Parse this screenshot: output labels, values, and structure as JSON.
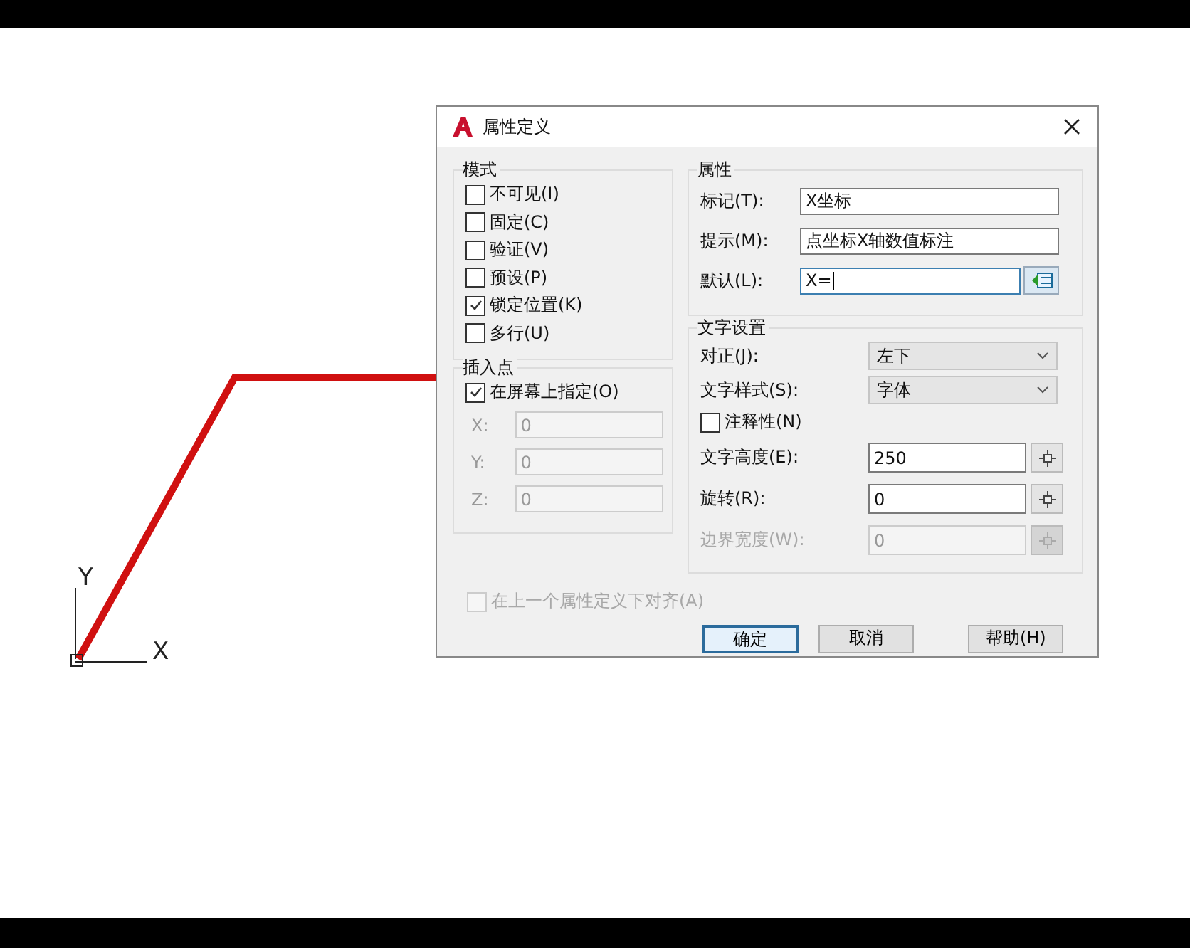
{
  "canvas": {
    "axis_labels": [
      "Y",
      "X"
    ]
  },
  "dialog": {
    "title": "属性定义",
    "mode": {
      "title": "模式",
      "items": [
        {
          "label": "不可见(I)",
          "checked": false
        },
        {
          "label": "固定(C)",
          "checked": false
        },
        {
          "label": "验证(V)",
          "checked": false
        },
        {
          "label": "预设(P)",
          "checked": false
        },
        {
          "label": "锁定位置(K)",
          "checked": true
        },
        {
          "label": "多行(U)",
          "checked": false
        }
      ]
    },
    "insertion_point": {
      "title": "插入点",
      "specify_on_screen": {
        "label": "在屏幕上指定(O)",
        "checked": true
      },
      "coordinates": [
        {
          "label": "X:",
          "value": "0",
          "disabled": true
        },
        {
          "label": "Y:",
          "value": "0",
          "disabled": true
        },
        {
          "label": "Z:",
          "value": "0",
          "disabled": true
        }
      ]
    },
    "attribute": {
      "title": "属性",
      "fields": [
        {
          "kind": "text",
          "label": "标记(T):",
          "value": "X坐标",
          "focused": false
        },
        {
          "kind": "text",
          "label": "提示(M):",
          "value": "点坐标X轴数值标注",
          "focused": false
        },
        {
          "kind": "field-button",
          "label": "默认(L):",
          "value": "X=",
          "focused": true
        }
      ]
    },
    "text_settings": {
      "title": "文字设置",
      "rows": [
        {
          "kind": "dropdown",
          "label": "对正(J):",
          "value": "左下",
          "disabled": false
        },
        {
          "kind": "dropdown",
          "label": "文字样式(S):",
          "value": "字体",
          "disabled": false
        },
        {
          "kind": "checkbox",
          "label": "注释性(N)",
          "checked": false,
          "disabled": false
        },
        {
          "kind": "pick",
          "label": "文字高度(E):",
          "value": "250",
          "disabled": false
        },
        {
          "kind": "pick",
          "label": "旋转(R):",
          "value": "0",
          "disabled": false
        },
        {
          "kind": "pick",
          "label": "边界宽度(W):",
          "value": "0",
          "disabled": true
        }
      ]
    },
    "align_below": {
      "label": "在上一个属性定义下对齐(A)",
      "checked": false,
      "disabled": true
    },
    "buttons": [
      {
        "label": "确定",
        "default": true
      },
      {
        "label": "取消",
        "default": false
      },
      {
        "label": "帮助(H)",
        "default": false
      }
    ]
  }
}
